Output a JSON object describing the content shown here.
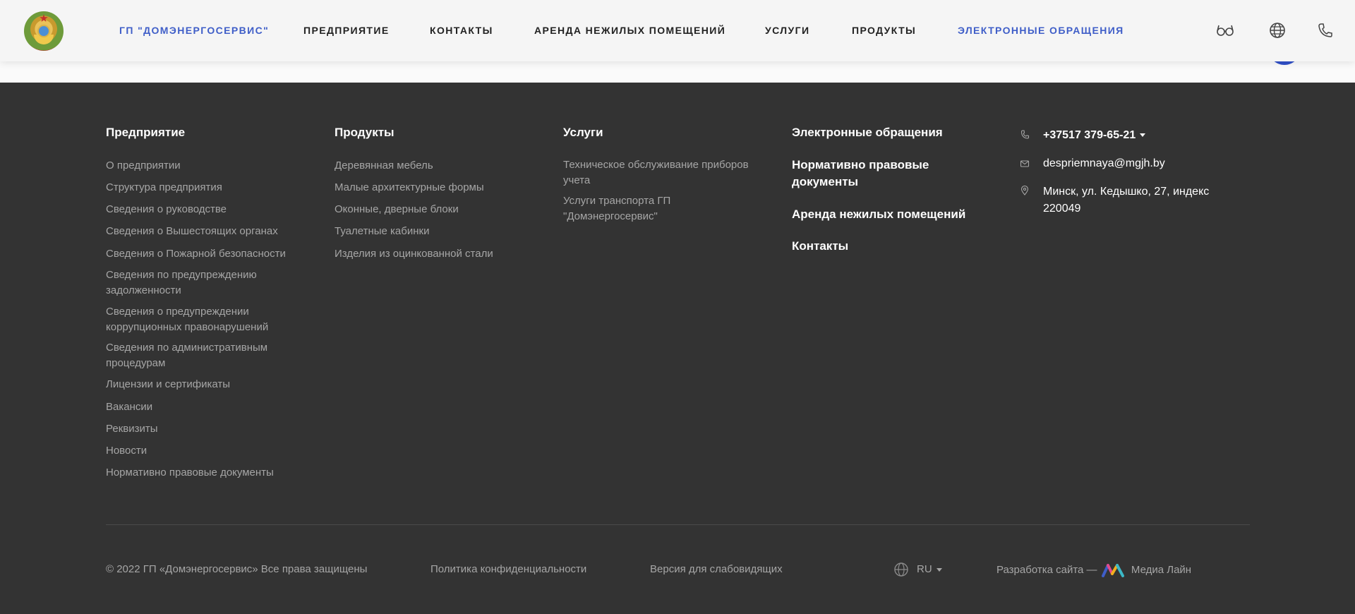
{
  "header": {
    "nav": [
      {
        "label": "ГП \"ДОМЭНЕРГОСЕРВИС\"",
        "accent": true
      },
      {
        "label": "ПРЕДПРИЯТИЕ",
        "accent": false
      },
      {
        "label": "КОНТАКТЫ",
        "accent": false
      },
      {
        "label": "АРЕНДА НЕЖИЛЫХ ПОМЕЩЕНИЙ",
        "accent": false
      },
      {
        "label": "УСЛУГИ",
        "accent": false
      },
      {
        "label": "ПРОДУКТЫ",
        "accent": false
      },
      {
        "label": "ЭЛЕКТРОННЫЕ ОБРАЩЕНИЯ",
        "accent": true
      }
    ],
    "icons": [
      "glasses-icon",
      "globe-icon",
      "phone-icon"
    ],
    "accent_color": "#3f5ec8"
  },
  "footer": {
    "enterprise": {
      "title": "Предприятие",
      "links": [
        "О предприятии",
        "Структура предприятия",
        "Сведения о руководстве",
        "Сведения о Вышестоящих органах",
        "Сведения о Пожарной безопасности",
        "Сведения по предупреждению задолженности",
        "Сведения о предупреждении коррупционных правонарушений",
        "Сведения по административным процедурам",
        "Лицензии и сертификаты",
        "Вакансии",
        "Реквизиты",
        "Новости",
        "Нормативно правовые документы"
      ]
    },
    "products": {
      "title": "Продукты",
      "links": [
        "Деревянная мебель",
        "Малые архитектурные формы",
        "Оконные, дверные блоки",
        "Туалетные кабинки",
        "Изделия из оцинкованной стали"
      ]
    },
    "services": {
      "title": "Услуги",
      "links": [
        "Техническое обслуживание приборов учета",
        "Услуги транспорта ГП \"Домэнергосервис\""
      ]
    },
    "appeals": {
      "title": "Электронные обращения",
      "links": [
        "Нормативно правовые документы",
        "Аренда нежилых помещений",
        "Контакты"
      ]
    },
    "contacts": {
      "phone": "+37517 379-65-21",
      "email": "despriemnaya@mgjh.by",
      "address": "Минск, ул. Кедышко, 27, индекс 220049"
    },
    "bottom": {
      "copyright": "© 2022 ГП «Домэнергосервис» Все права защищены",
      "privacy": "Политика конфиденциальности",
      "accessibility": "Версия для слабовидящих",
      "language": "RU",
      "developer_prefix": "Разработка сайта —",
      "developer_name": "Медиа Лайн"
    }
  }
}
